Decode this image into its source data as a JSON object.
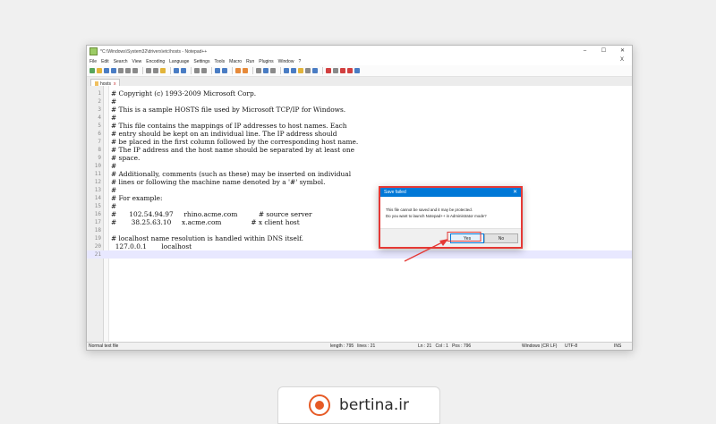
{
  "window": {
    "title": "*C:\\Windows\\System32\\drivers\\etc\\hosts - Notepad++",
    "controls": {
      "minimize": "–",
      "maximize": "☐",
      "close": "✕"
    }
  },
  "menu": {
    "items": [
      "File",
      "Edit",
      "Search",
      "View",
      "Encoding",
      "Language",
      "Settings",
      "Tools",
      "Macro",
      "Run",
      "Plugins",
      "Window",
      "?"
    ],
    "close": "X"
  },
  "toolbar": {
    "icons": [
      "new-file-icon",
      "open-file-icon",
      "save-icon",
      "save-all-icon",
      "close-icon",
      "close-all-icon",
      "print-icon",
      "cut-icon",
      "copy-icon",
      "paste-icon",
      "undo-icon",
      "redo-icon",
      "find-icon",
      "replace-icon",
      "zoom-in-icon",
      "zoom-out-icon",
      "sync-v-icon",
      "sync-h-icon",
      "wrap-icon",
      "all-chars-icon",
      "indent-guide-icon",
      "udl-icon",
      "doc-map-icon",
      "function-list-icon",
      "folder-workspace-icon",
      "monitoring-icon",
      "record-macro-icon",
      "stop-record-icon",
      "playback-icon",
      "run-macro-icon",
      "save-macro-icon"
    ]
  },
  "tab": {
    "label": "hosts",
    "close": "x"
  },
  "editor": {
    "lines": [
      {
        "n": "1",
        "text": "# Copyright (c) 1993-2009 Microsoft Corp."
      },
      {
        "n": "2",
        "text": "#"
      },
      {
        "n": "3",
        "text": "# This is a sample HOSTS file used by Microsoft TCP/IP for Windows."
      },
      {
        "n": "4",
        "text": "#"
      },
      {
        "n": "5",
        "text": "# This file contains the mappings of IP addresses to host names. Each"
      },
      {
        "n": "6",
        "text": "# entry should be kept on an individual line. The IP address should"
      },
      {
        "n": "7",
        "text": "# be placed in the first column followed by the corresponding host name."
      },
      {
        "n": "8",
        "text": "# The IP address and the host name should be separated by at least one"
      },
      {
        "n": "9",
        "text": "# space."
      },
      {
        "n": "10",
        "text": "#"
      },
      {
        "n": "11",
        "text": "# Additionally, comments (such as these) may be inserted on individual"
      },
      {
        "n": "12",
        "text": "# lines or following the machine name denoted by a '#' symbol."
      },
      {
        "n": "13",
        "text": "#"
      },
      {
        "n": "14",
        "text": "# For example:"
      },
      {
        "n": "15",
        "text": "#"
      },
      {
        "n": "16",
        "text": "#      102.54.94.97     rhino.acme.com          # source server"
      },
      {
        "n": "17",
        "text": "#       38.25.63.10     x.acme.com              # x client host"
      },
      {
        "n": "18",
        "text": ""
      },
      {
        "n": "19",
        "text": "# localhost name resolution is handled within DNS itself."
      },
      {
        "n": "20",
        "text": "  127.0.0.1       localhost"
      },
      {
        "n": "21",
        "text": ""
      }
    ]
  },
  "status": {
    "file_type": "Normal text file",
    "length": "length : 795   lines : 21",
    "position": "Ln : 21   Col : 1   Pos : 796",
    "eol": "Windows (CR LF)",
    "encoding": "UTF-8",
    "mode": "INS"
  },
  "dialog": {
    "title": "Save failed",
    "close": "✕",
    "line1": "This file cannot be saved and it may be protected.",
    "line2": "Do you want to launch Notepad++ in Administrator mode?",
    "yes": "Yes",
    "no": "No"
  },
  "brand": {
    "text": "bertina.ir"
  },
  "colors": {
    "dialog_border": "#e53935",
    "dialog_title": "#0078d7",
    "arrow": "#e53935",
    "brand": "#e65a25"
  }
}
